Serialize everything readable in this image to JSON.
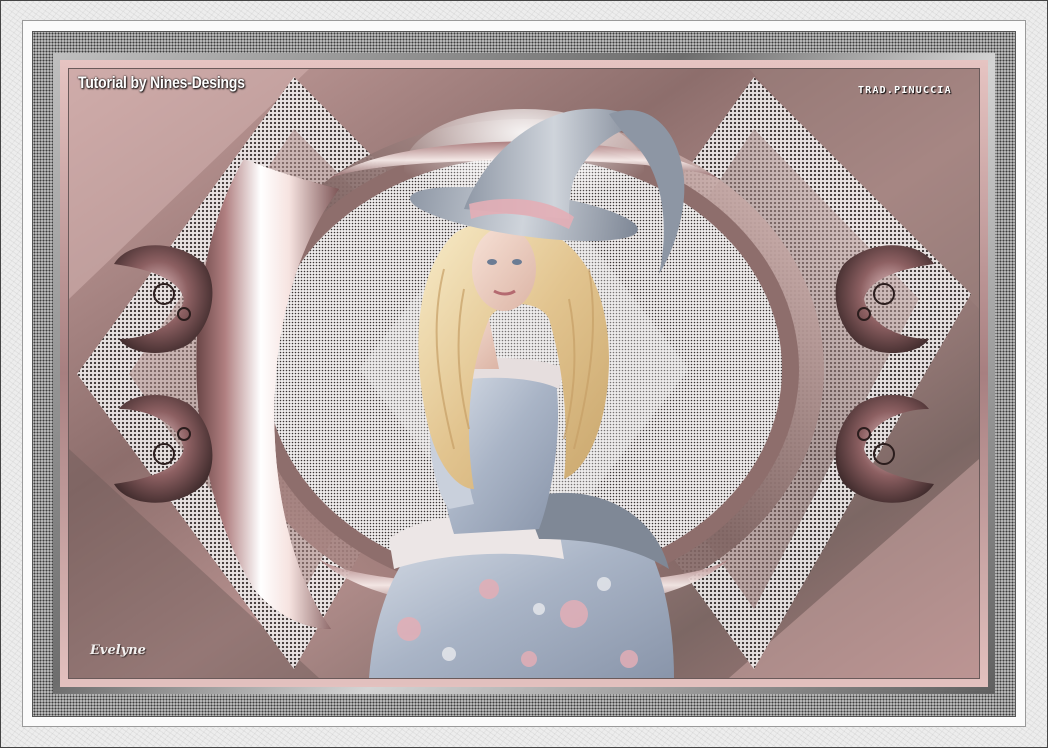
{
  "image": {
    "title_text": "Tutorial by Nines-Desings",
    "translator_text": "TRAD.PINUCCIA",
    "signature_text": "Evelyne",
    "palette": {
      "rose": "#c99a98",
      "rose_dark": "#8a5f60",
      "taupe": "#8c7f78",
      "silver": "#c8cbd0",
      "hair": "#e9d3a6",
      "dress_blue": "#b9c3d3",
      "flower_pink": "#e3aeb6"
    }
  }
}
